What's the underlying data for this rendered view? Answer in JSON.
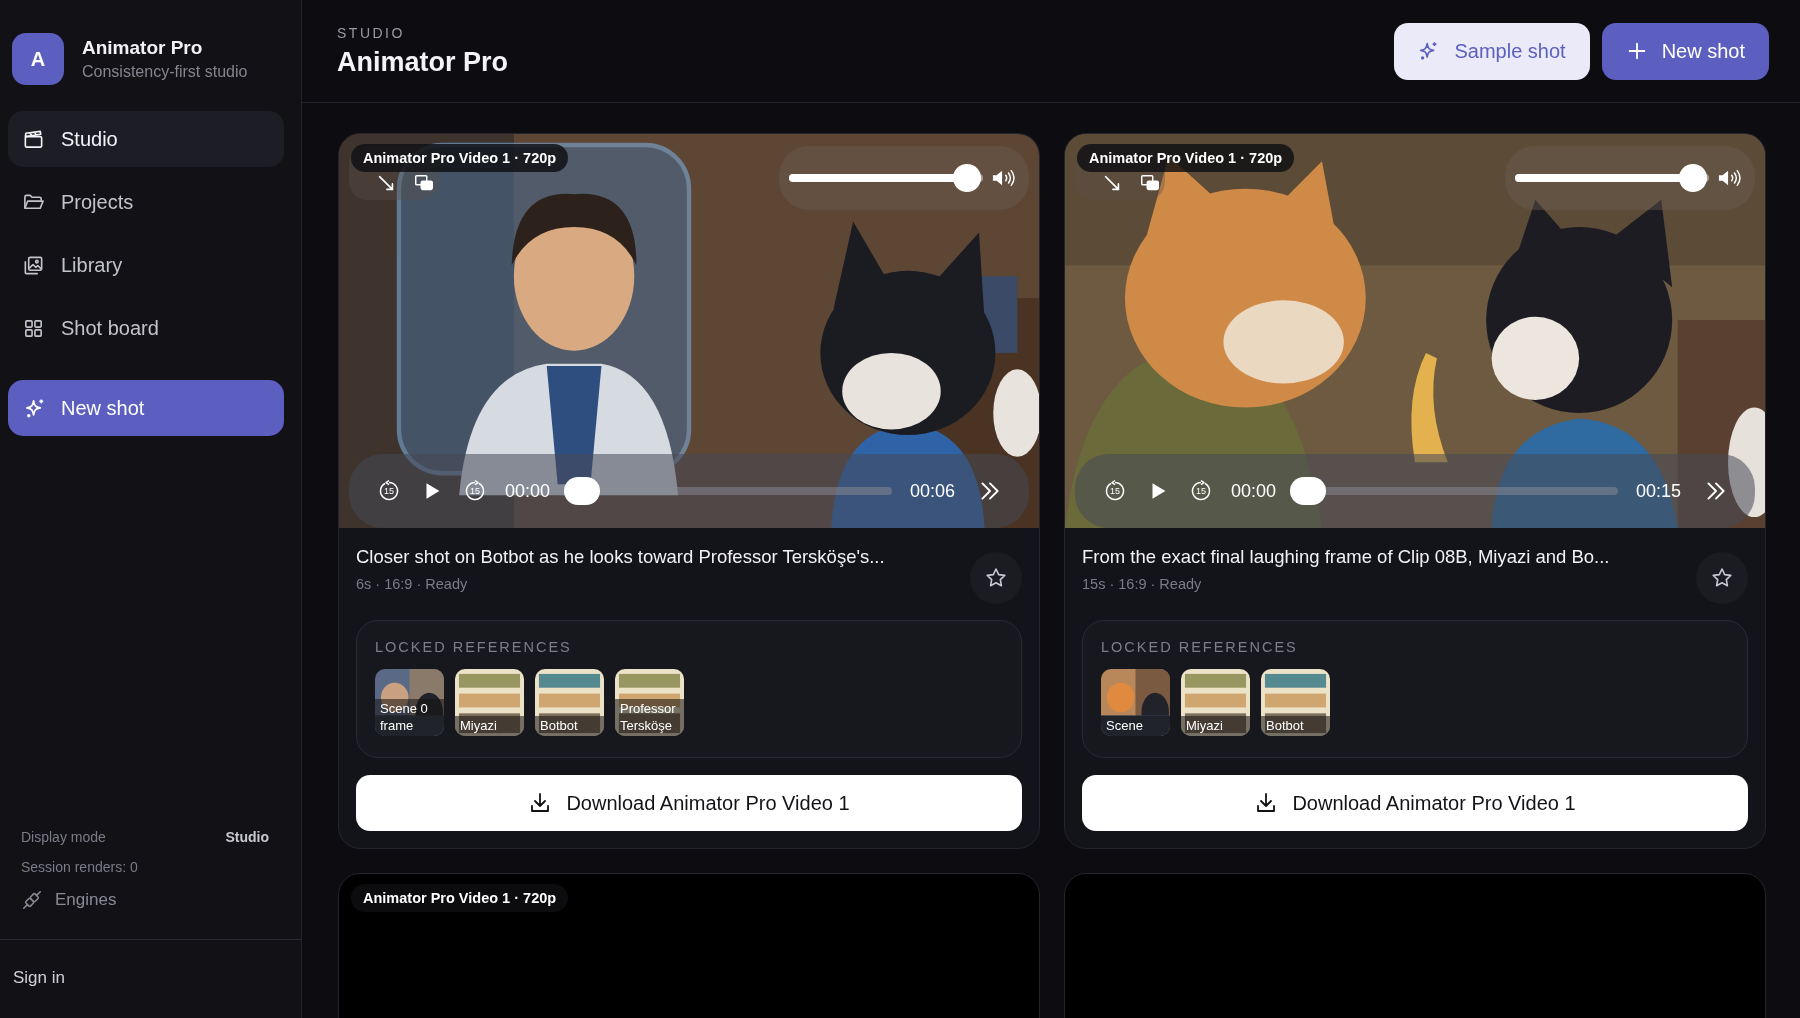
{
  "sidebar": {
    "brand": {
      "initial": "A",
      "name": "Animator Pro",
      "tagline": "Consistency-first studio"
    },
    "nav": [
      {
        "label": "Studio",
        "selected": true
      },
      {
        "label": "Projects",
        "selected": false
      },
      {
        "label": "Library",
        "selected": false
      },
      {
        "label": "Shot board",
        "selected": false
      }
    ],
    "new_shot": "New shot",
    "display_mode": {
      "label": "Display mode",
      "value": "Studio"
    },
    "session_renders": "Session renders: 0",
    "engines": "Engines",
    "sign_in": "Sign in"
  },
  "header": {
    "eyebrow": "STUDIO",
    "title": "Animator Pro",
    "buttons": [
      {
        "label": "Sample shot",
        "kind": "secondary"
      },
      {
        "label": "New shot",
        "kind": "primary"
      }
    ]
  },
  "shots": [
    {
      "video": {
        "kind": "picture",
        "badge": "Animator Pro Video 1 · 720p",
        "volume": {
          "level": 0.92
        },
        "skip_back": "15",
        "skip_forward": "15",
        "current": "00:00",
        "progress": {
          "level": 0
        },
        "duration": "00:06"
      },
      "title": "Closer shot on Botbot as he looks toward Professor Tersköşe's...",
      "meta": "6s · 16:9 · Ready",
      "references": {
        "heading": "LOCKED REFERENCES",
        "items": [
          {
            "label": "Scene 0 frame"
          },
          {
            "label": "Miyazi"
          },
          {
            "label": "Botbot"
          },
          {
            "label": "Professor Tersköşe"
          }
        ]
      },
      "download": "Download Animator Pro Video 1"
    },
    {
      "video": {
        "kind": "picture",
        "badge": "Animator Pro Video 1 · 720p",
        "volume": {
          "level": 0.92
        },
        "skip_back": "15",
        "skip_forward": "15",
        "current": "00:00",
        "progress": {
          "level": 0
        },
        "duration": "00:15"
      },
      "title": "From the exact final laughing frame of Clip 08B, Miyazi and Bo...",
      "meta": "15s · 16:9 · Ready",
      "references": {
        "heading": "LOCKED REFERENCES",
        "items": [
          {
            "label": "Scene"
          },
          {
            "label": "Miyazi"
          },
          {
            "label": "Botbot"
          }
        ]
      },
      "download": "Download Animator Pro Video 1"
    },
    {
      "video": {
        "kind": "blank",
        "badge": "Animator Pro Video 1 · 720p"
      }
    },
    {
      "video": {
        "kind": "blank"
      }
    }
  ]
}
